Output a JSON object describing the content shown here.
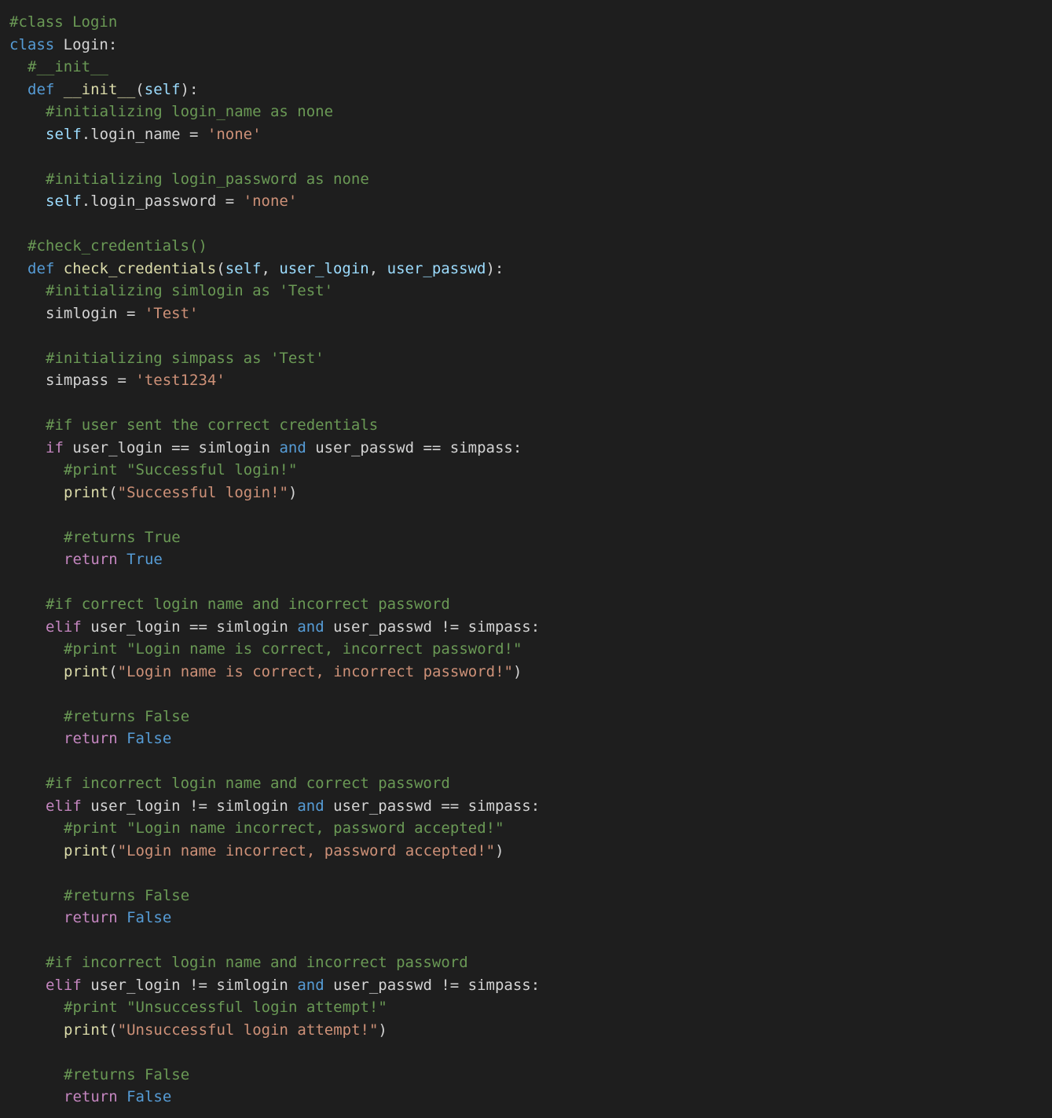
{
  "colors": {
    "background": "#1e1e1e",
    "comment": "#6a9955",
    "keyword_blue": "#569cd6",
    "keyword_purple": "#c586c0",
    "variable": "#9cdcfe",
    "function": "#dcdcaa",
    "string": "#ce9178",
    "default_text": "#d4d4d4"
  },
  "code": {
    "lines": [
      {
        "indent": 0,
        "tokens": [
          {
            "t": "comment",
            "v": "#class Login"
          }
        ]
      },
      {
        "indent": 0,
        "tokens": [
          {
            "t": "storage",
            "v": "class"
          },
          {
            "t": "plain",
            "v": " "
          },
          {
            "t": "class",
            "v": "Login"
          },
          {
            "t": "plain",
            "v": ":"
          }
        ]
      },
      {
        "indent": 1,
        "tokens": [
          {
            "t": "comment",
            "v": "#__init__"
          }
        ]
      },
      {
        "indent": 1,
        "tokens": [
          {
            "t": "storage",
            "v": "def"
          },
          {
            "t": "plain",
            "v": " "
          },
          {
            "t": "func",
            "v": "__init__"
          },
          {
            "t": "plain",
            "v": "("
          },
          {
            "t": "param",
            "v": "self"
          },
          {
            "t": "plain",
            "v": "):"
          }
        ]
      },
      {
        "indent": 2,
        "tokens": [
          {
            "t": "comment",
            "v": "#initializing login_name as none"
          }
        ]
      },
      {
        "indent": 2,
        "tokens": [
          {
            "t": "self",
            "v": "self"
          },
          {
            "t": "plain",
            "v": ".login_name = "
          },
          {
            "t": "string",
            "v": "'none'"
          }
        ]
      },
      {
        "indent": 0,
        "tokens": []
      },
      {
        "indent": 2,
        "tokens": [
          {
            "t": "comment",
            "v": "#initializing login_password as none"
          }
        ]
      },
      {
        "indent": 2,
        "tokens": [
          {
            "t": "self",
            "v": "self"
          },
          {
            "t": "plain",
            "v": ".login_password = "
          },
          {
            "t": "string",
            "v": "'none'"
          }
        ]
      },
      {
        "indent": 0,
        "tokens": []
      },
      {
        "indent": 1,
        "tokens": [
          {
            "t": "comment",
            "v": "#check_credentials()"
          }
        ]
      },
      {
        "indent": 1,
        "tokens": [
          {
            "t": "storage",
            "v": "def"
          },
          {
            "t": "plain",
            "v": " "
          },
          {
            "t": "func",
            "v": "check_credentials"
          },
          {
            "t": "plain",
            "v": "("
          },
          {
            "t": "param",
            "v": "self"
          },
          {
            "t": "plain",
            "v": ", "
          },
          {
            "t": "param",
            "v": "user_login"
          },
          {
            "t": "plain",
            "v": ", "
          },
          {
            "t": "param",
            "v": "user_passwd"
          },
          {
            "t": "plain",
            "v": "):"
          }
        ]
      },
      {
        "indent": 2,
        "tokens": [
          {
            "t": "comment",
            "v": "#initializing simlogin as 'Test'"
          }
        ]
      },
      {
        "indent": 2,
        "tokens": [
          {
            "t": "plain",
            "v": "simlogin = "
          },
          {
            "t": "string",
            "v": "'Test'"
          }
        ]
      },
      {
        "indent": 0,
        "tokens": []
      },
      {
        "indent": 2,
        "tokens": [
          {
            "t": "comment",
            "v": "#initializing simpass as 'Test'"
          }
        ]
      },
      {
        "indent": 2,
        "tokens": [
          {
            "t": "plain",
            "v": "simpass = "
          },
          {
            "t": "string",
            "v": "'test1234'"
          }
        ]
      },
      {
        "indent": 0,
        "tokens": []
      },
      {
        "indent": 2,
        "tokens": [
          {
            "t": "comment",
            "v": "#if user sent the correct credentials"
          }
        ]
      },
      {
        "indent": 2,
        "tokens": [
          {
            "t": "keyword",
            "v": "if"
          },
          {
            "t": "plain",
            "v": " user_login == simlogin "
          },
          {
            "t": "storage",
            "v": "and"
          },
          {
            "t": "plain",
            "v": " user_passwd == simpass:"
          }
        ]
      },
      {
        "indent": 3,
        "tokens": [
          {
            "t": "comment",
            "v": "#print \"Successful login!\""
          }
        ]
      },
      {
        "indent": 3,
        "tokens": [
          {
            "t": "func",
            "v": "print"
          },
          {
            "t": "plain",
            "v": "("
          },
          {
            "t": "string",
            "v": "\"Successful login!\""
          },
          {
            "t": "plain",
            "v": ")"
          }
        ]
      },
      {
        "indent": 0,
        "tokens": []
      },
      {
        "indent": 3,
        "tokens": [
          {
            "t": "comment",
            "v": "#returns True"
          }
        ]
      },
      {
        "indent": 3,
        "tokens": [
          {
            "t": "keyword",
            "v": "return"
          },
          {
            "t": "plain",
            "v": " "
          },
          {
            "t": "const",
            "v": "True"
          }
        ]
      },
      {
        "indent": 0,
        "tokens": []
      },
      {
        "indent": 2,
        "tokens": [
          {
            "t": "comment",
            "v": "#if correct login name and incorrect password"
          }
        ]
      },
      {
        "indent": 2,
        "tokens": [
          {
            "t": "keyword",
            "v": "elif"
          },
          {
            "t": "plain",
            "v": " user_login == simlogin "
          },
          {
            "t": "storage",
            "v": "and"
          },
          {
            "t": "plain",
            "v": " user_passwd != simpass:"
          }
        ]
      },
      {
        "indent": 3,
        "tokens": [
          {
            "t": "comment",
            "v": "#print \"Login name is correct, incorrect password!\""
          }
        ]
      },
      {
        "indent": 3,
        "tokens": [
          {
            "t": "func",
            "v": "print"
          },
          {
            "t": "plain",
            "v": "("
          },
          {
            "t": "string",
            "v": "\"Login name is correct, incorrect password!\""
          },
          {
            "t": "plain",
            "v": ")"
          }
        ]
      },
      {
        "indent": 0,
        "tokens": []
      },
      {
        "indent": 3,
        "tokens": [
          {
            "t": "comment",
            "v": "#returns False"
          }
        ]
      },
      {
        "indent": 3,
        "tokens": [
          {
            "t": "keyword",
            "v": "return"
          },
          {
            "t": "plain",
            "v": " "
          },
          {
            "t": "const",
            "v": "False"
          }
        ]
      },
      {
        "indent": 0,
        "tokens": []
      },
      {
        "indent": 2,
        "tokens": [
          {
            "t": "comment",
            "v": "#if incorrect login name and correct password"
          }
        ]
      },
      {
        "indent": 2,
        "tokens": [
          {
            "t": "keyword",
            "v": "elif"
          },
          {
            "t": "plain",
            "v": " user_login != simlogin "
          },
          {
            "t": "storage",
            "v": "and"
          },
          {
            "t": "plain",
            "v": " user_passwd == simpass:"
          }
        ]
      },
      {
        "indent": 3,
        "tokens": [
          {
            "t": "comment",
            "v": "#print \"Login name incorrect, password accepted!\""
          }
        ]
      },
      {
        "indent": 3,
        "tokens": [
          {
            "t": "func",
            "v": "print"
          },
          {
            "t": "plain",
            "v": "("
          },
          {
            "t": "string",
            "v": "\"Login name incorrect, password accepted!\""
          },
          {
            "t": "plain",
            "v": ")"
          }
        ]
      },
      {
        "indent": 0,
        "tokens": []
      },
      {
        "indent": 3,
        "tokens": [
          {
            "t": "comment",
            "v": "#returns False"
          }
        ]
      },
      {
        "indent": 3,
        "tokens": [
          {
            "t": "keyword",
            "v": "return"
          },
          {
            "t": "plain",
            "v": " "
          },
          {
            "t": "const",
            "v": "False"
          }
        ]
      },
      {
        "indent": 0,
        "tokens": []
      },
      {
        "indent": 2,
        "tokens": [
          {
            "t": "comment",
            "v": "#if incorrect login name and incorrect password"
          }
        ]
      },
      {
        "indent": 2,
        "tokens": [
          {
            "t": "keyword",
            "v": "elif"
          },
          {
            "t": "plain",
            "v": " user_login != simlogin "
          },
          {
            "t": "storage",
            "v": "and"
          },
          {
            "t": "plain",
            "v": " user_passwd != simpass:"
          }
        ]
      },
      {
        "indent": 3,
        "tokens": [
          {
            "t": "comment",
            "v": "#print \"Unsuccessful login attempt!\""
          }
        ]
      },
      {
        "indent": 3,
        "tokens": [
          {
            "t": "func",
            "v": "print"
          },
          {
            "t": "plain",
            "v": "("
          },
          {
            "t": "string",
            "v": "\"Unsuccessful login attempt!\""
          },
          {
            "t": "plain",
            "v": ")"
          }
        ]
      },
      {
        "indent": 0,
        "tokens": []
      },
      {
        "indent": 3,
        "tokens": [
          {
            "t": "comment",
            "v": "#returns False"
          }
        ]
      },
      {
        "indent": 3,
        "tokens": [
          {
            "t": "keyword",
            "v": "return"
          },
          {
            "t": "plain",
            "v": " "
          },
          {
            "t": "const",
            "v": "False"
          }
        ]
      }
    ]
  }
}
